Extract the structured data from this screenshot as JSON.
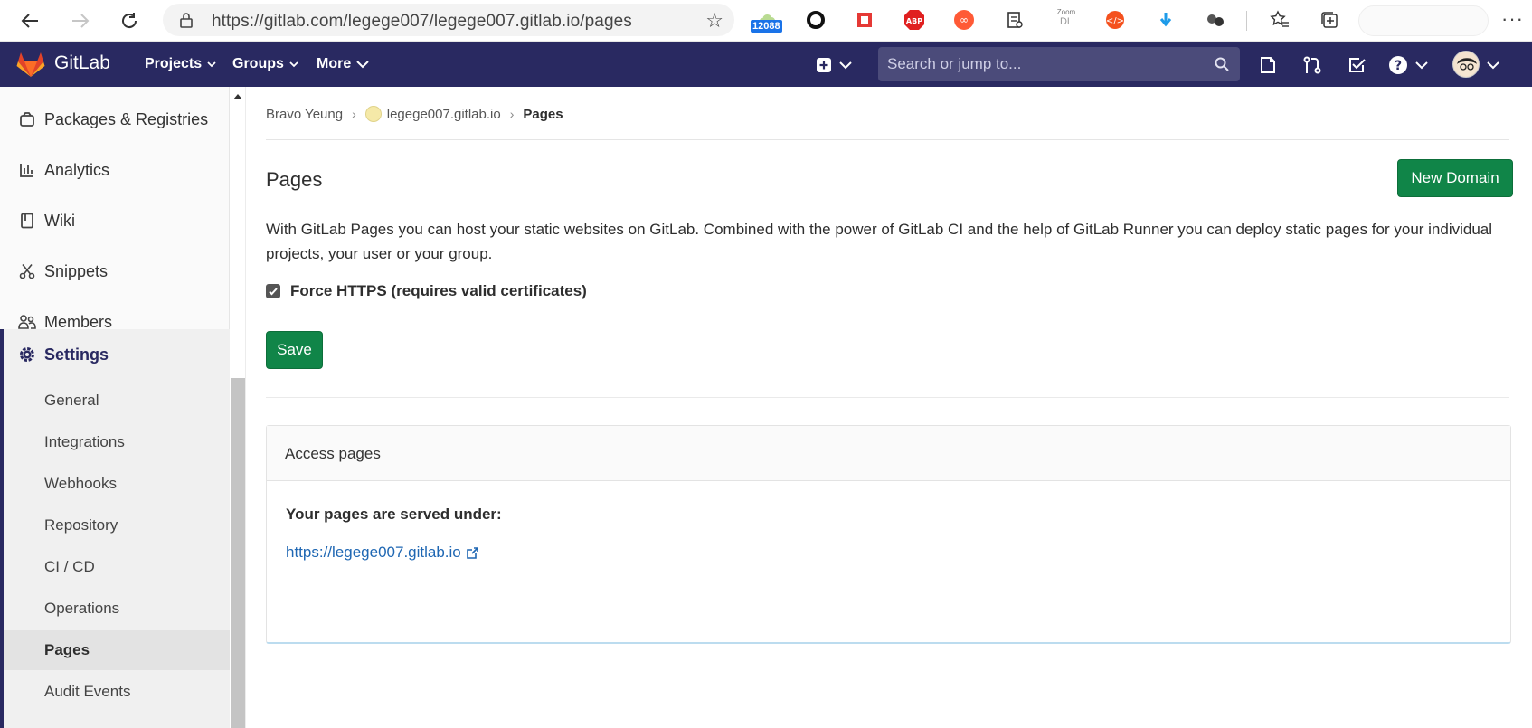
{
  "browser": {
    "url": "https://gitlab.com/legege007/legege007.gitlab.io/pages",
    "extension_badge": "12088",
    "zoom_label": "Zoom",
    "zoom_sub": "DL",
    "more": "···"
  },
  "topnav": {
    "brand": "GitLab",
    "menus": [
      "Projects",
      "Groups",
      "More"
    ],
    "search_placeholder": "Search or jump to..."
  },
  "sidebar": {
    "items": [
      {
        "label": "Packages & Registries",
        "icon": "package-icon"
      },
      {
        "label": "Analytics",
        "icon": "analytics-icon"
      },
      {
        "label": "Wiki",
        "icon": "book-icon"
      },
      {
        "label": "Snippets",
        "icon": "scissors-icon"
      },
      {
        "label": "Members",
        "icon": "users-icon"
      }
    ],
    "settings_label": "Settings",
    "settings_sub": [
      "General",
      "Integrations",
      "Webhooks",
      "Repository",
      "CI / CD",
      "Operations",
      "Pages",
      "Audit Events"
    ]
  },
  "breadcrumb": [
    "Bravo Yeung",
    "legege007.gitlab.io",
    "Pages"
  ],
  "main": {
    "title": "Pages",
    "new_domain_label": "New Domain",
    "description": "With GitLab Pages you can host your static websites on GitLab. Combined with the power of GitLab CI and the help of GitLab Runner you can deploy static pages for your individual projects, your user or your group.",
    "force_https_label": "Force HTTPS (requires valid certificates)",
    "save_label": "Save",
    "access_card": {
      "header": "Access pages",
      "served_label": "Your pages are served under:",
      "link": "https://legege007.gitlab.io"
    }
  },
  "colors": {
    "nav_bg": "#292961",
    "button_green": "#108548",
    "link_blue": "#1f67b3"
  }
}
